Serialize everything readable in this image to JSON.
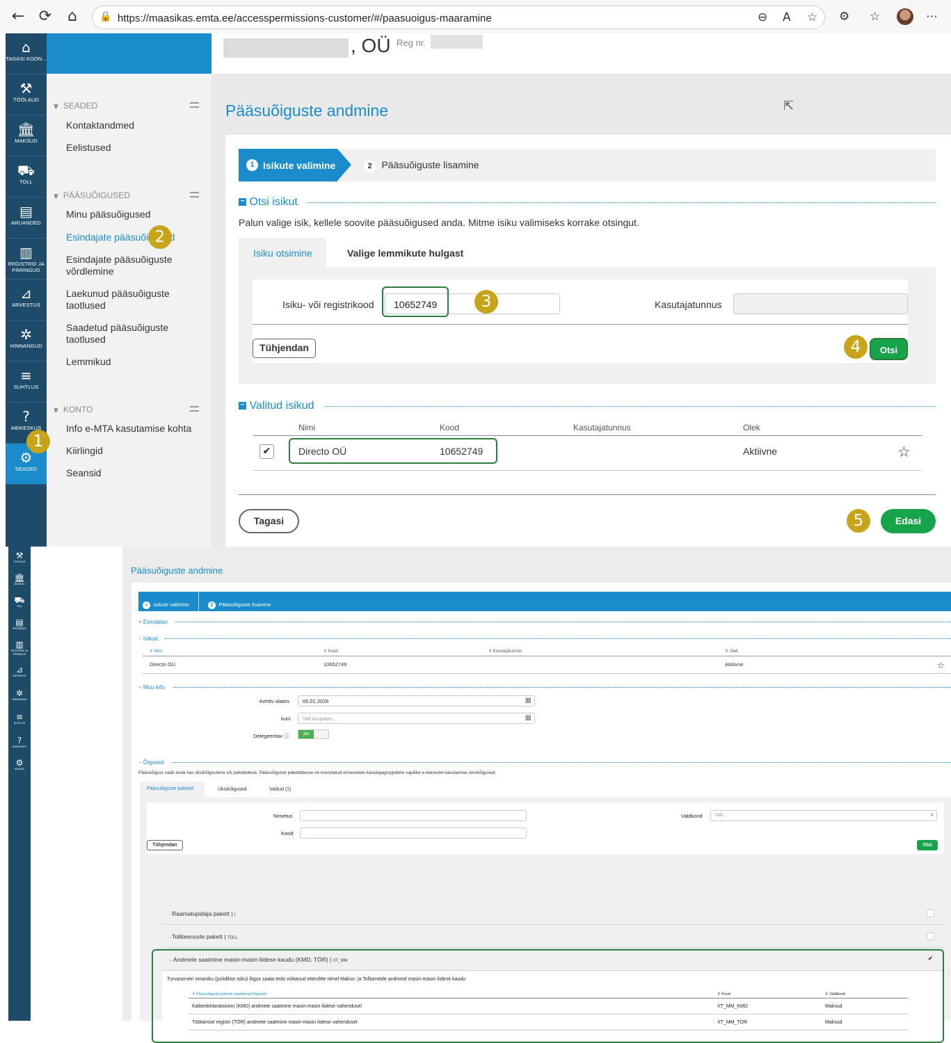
{
  "browser": {
    "url": "https://maasikas.emta.ee/accesspermissions-customer/#/paasuoigus-maaramine",
    "back_icon": "←",
    "reload_icon": "⟳",
    "home_icon": "⌂",
    "lock_icon": "🔒",
    "zoom_icon": "⊖",
    "read_icon": "A",
    "fav_icon": "☆",
    "ext_icon": "⚙",
    "favs_icon": "☆",
    "more_icon": "⋯"
  },
  "header": {
    "company_suffix": ", OÜ",
    "reg_label": "Reg nr."
  },
  "rail": {
    "items": [
      {
        "icon": "⌂",
        "label": "TAGASI KOON..."
      },
      {
        "icon": "⚒",
        "label": "TÖÖLAUD"
      },
      {
        "icon": "🏛",
        "label": "MAKSUD"
      },
      {
        "icon": "⛟",
        "label": "TOLL"
      },
      {
        "icon": "▤",
        "label": "ARUANDED"
      },
      {
        "icon": "▥",
        "label": "REGISTRID JA PÄRINGUD"
      },
      {
        "icon": "⊿",
        "label": "ARVESTUS"
      },
      {
        "icon": "✲",
        "label": "HINNANGUD"
      },
      {
        "icon": "≡",
        "label": "SUHTLUS"
      },
      {
        "icon": "?",
        "label": "ABIKESKUS"
      },
      {
        "icon": "⚙",
        "label": "SEADED"
      }
    ]
  },
  "sidebar": {
    "sections": [
      {
        "title": "SEADED",
        "items": [
          "Kontaktandmed",
          "Eelistused"
        ]
      },
      {
        "title": "PÄÄSUÕIGUSED",
        "items": [
          "Minu pääsuõigused",
          "Esindajate pääsuõigused",
          "Esindajate pääsuõiguste võrdlemine",
          "Laekunud pääsuõiguste taotlused",
          "Saadetud pääsuõiguste taotlused",
          "Lemmikud"
        ]
      },
      {
        "title": "KONTO",
        "items": [
          "Info e-MTA kasutamise kohta",
          "Kiirlingid",
          "Seansid"
        ]
      }
    ]
  },
  "top": {
    "page_title": "Pääsuõiguste andmine",
    "steps": [
      {
        "num": "1",
        "label": "Isikute valimine"
      },
      {
        "num": "2",
        "label": "Pääsuõiguste lisamine"
      }
    ],
    "search_section": "Otsi isikut",
    "instructions": "Palun valige isik, kellele soovite pääsuõigused anda. Mitme isiku valimiseks korrake otsingut.",
    "tabs": [
      "Isiku otsimine",
      "Valige lemmikute hulgast"
    ],
    "code_label": "Isiku- või registrikood",
    "code_value": "10652749",
    "username_label": "Kasutajatunnus",
    "clear_button": "Tühjendan",
    "search_button": "Otsi",
    "selected_section": "Valitud isikud",
    "table_headers": [
      "Nimi",
      "Kood",
      "Kasutajatunnus",
      "Olek"
    ],
    "row": {
      "name": "Directo OÜ",
      "code": "10652749",
      "username": "",
      "status": "Aktiivne"
    },
    "back_button": "Tagasi",
    "next_button": "Edasi",
    "badges": [
      "1",
      "2",
      "3",
      "4",
      "5"
    ]
  },
  "bottom": {
    "page_title": "Pääsuõiguste andmine",
    "steps": [
      {
        "num": "✓",
        "label": "Isikute valimine"
      },
      {
        "num": "2",
        "label": "Pääsuõiguste lisamine"
      }
    ],
    "representable": "Esindatav",
    "persons": "Isikud",
    "table_headers": [
      "⇕ Nimi",
      "⇕ Kood",
      "⇕ Kasutajatunnus",
      "⇕ Olek"
    ],
    "row": {
      "name": "Directo OÜ",
      "code": "10652749",
      "username": "",
      "status": "Aktiivne"
    },
    "more_info": "Muu info",
    "valid_from_label": "Kehtiv alates",
    "valid_from_value": "05.01.2026",
    "until_label": "kuni",
    "until_placeholder": "Vali kuupäev...",
    "delegable_label": "Delegeeritav ⓘ",
    "toggle_on": "Jah",
    "rights": "Õigused",
    "rights_desc": "Pääsuõigusi saab anda kas üksikõigustena või pakettidena. Pääsuõiguste pakettidesse on koondatud erinevatele kasutajagruppidele vajalike e-teenuste kasutamise üksikõigused.",
    "tabs": [
      "Pääsuõiguste paketid",
      "Üksikõigused",
      "Valitud (1)"
    ],
    "name_label": "Nimetus",
    "code_label": "Kood",
    "domain_label": "Valdkond",
    "domain_placeholder": "Vali...",
    "clear_button": "Tühjendan",
    "search_button": "Otsi",
    "packages": [
      {
        "label": "Raamatupidaja pakett",
        "code": "I"
      },
      {
        "label": "Tolliteenuste pakett",
        "code": "TOLL"
      },
      {
        "label": "Andmete saatmine masin-masin liidese kaudu (KMD, TÖR)",
        "code": "XT_MM"
      }
    ],
    "package_desc": "Turvaserveri omaniku (juriidilise isiku) õigus saata teda volitanud ettevõtte nimel Maksu- ja Tolliametile andmeid masin-masin liidese kaudu",
    "inner_headers": [
      "⇕ Pääsuõiguste paketis sisalduvad õigused",
      "⇕ Kood",
      "⇕ Valdkond"
    ],
    "inner_rows": [
      {
        "right": "Käibedeklaratsiooni (KMD) andmete saatmine masin-masin liidese vahendusel",
        "code": "XT_MM_KMD",
        "domain": "Maksud"
      },
      {
        "right": "Töötamise registri (TÖR) andmete saatmine masin-masin liidese vahendusel",
        "code": "XT_MM_TOR",
        "domain": "Maksud"
      }
    ]
  },
  "colors": {
    "brand_blue": "#1a8ccc",
    "rail": "#1d4b69",
    "green": "#16a34a",
    "badge": "#c8a41a",
    "highlight": "#2d7d3a"
  }
}
